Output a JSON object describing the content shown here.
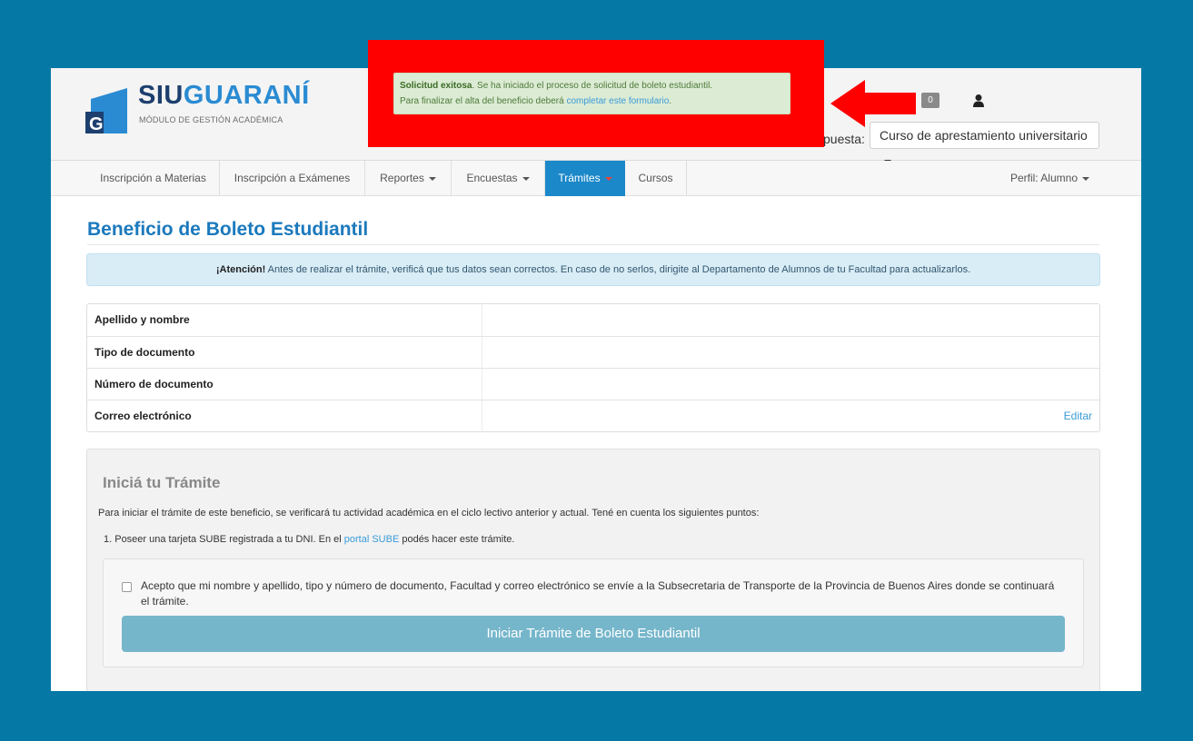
{
  "colors": {
    "background": "#0678a6",
    "brand_blue": "#1b88c9",
    "annotation_red": "#ff0000"
  },
  "header": {
    "logo": {
      "brand_part1": "SIU",
      "brand_part2": "GUARANÍ",
      "subtitle": "MÓDULO DE GESTIÓN ACADÉMICA",
      "mark_letter": "G"
    },
    "messages_badge": "0",
    "propuesta_label": "puesta:",
    "propuesta_value": "Curso de aprestamiento universitario"
  },
  "nav": {
    "items": [
      {
        "label": "Inscripción a Materias"
      },
      {
        "label": "Inscripción a Exámenes"
      },
      {
        "label": "Reportes"
      },
      {
        "label": "Encuestas"
      },
      {
        "label": "Trámites"
      },
      {
        "label": "Cursos"
      }
    ],
    "perfil": "Perfil: Alumno"
  },
  "success_notice": {
    "bold": "Solicitud exitosa",
    "text1": ". Se ha iniciado el proceso de solicitud de boleto estudiantil.",
    "text2": "Para finalizar el alta del beneficio deberá ",
    "link": "completar este formulario",
    "tail": "."
  },
  "page": {
    "title": "Beneficio de Boleto Estudiantil",
    "alert_bold": "¡Atención!",
    "alert_text": " Antes de realizar el trámite, verificá que tus datos sean correctos. En caso de no serlos, dirigite al Departamento de Alumnos de tu Facultad para actualizarlos.",
    "table": [
      {
        "label": "Apellido y nombre"
      },
      {
        "label": "Tipo de documento"
      },
      {
        "label": "Número de documento"
      },
      {
        "label": "Correo electrónico",
        "action": "Editar"
      }
    ]
  },
  "tramite": {
    "title": "Iniciá tu Trámite",
    "description": "Para iniciar el trámite de este beneficio, se verificará tu actividad académica en el ciclo lectivo anterior y actual. Tené en cuenta los siguientes puntos:",
    "point_prefix": "1. Poseer una tarjeta SUBE registrada a tu DNI. En el ",
    "point_link": "portal SUBE",
    "point_suffix": " podés hacer este trámite.",
    "accept_text": "Acepto que mi nombre y apellido, tipo y número de documento, Facultad y correo electrónico se envíe a la Subsecretaria de Transporte de la Provincia de Buenos Aires donde se continuará el trámite.",
    "button": "Iniciar Trámite de Boleto Estudiantil"
  }
}
